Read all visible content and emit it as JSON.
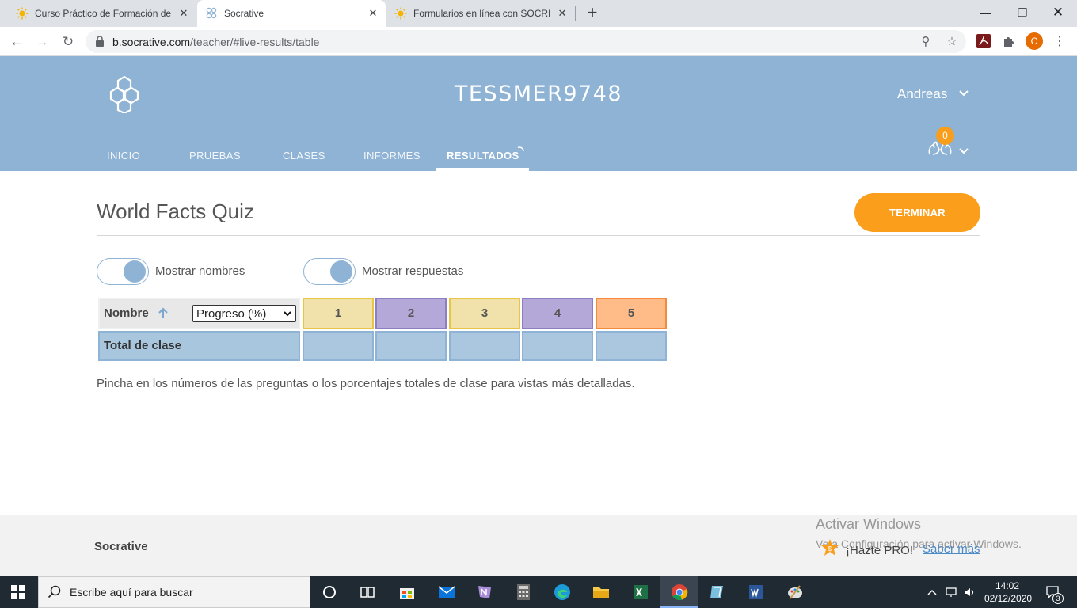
{
  "browser": {
    "tabs": [
      {
        "title": "Curso Práctico de Formación de P",
        "active": false
      },
      {
        "title": "Socrative",
        "active": true
      },
      {
        "title": "Formularios en línea con SOCREA",
        "active": false
      }
    ],
    "url_host": "b.socrative.com",
    "url_path": "/teacher/#live-results/table",
    "profile_initial": "C"
  },
  "header": {
    "room_name": "TESSMER9748",
    "user_name": "Andreas",
    "hands_count": "0",
    "nav": [
      {
        "label": "INICIO"
      },
      {
        "label": "PRUEBAS"
      },
      {
        "label": "CLASES"
      },
      {
        "label": "INFORMES"
      },
      {
        "label": "RESULTADOS",
        "active": true
      }
    ]
  },
  "main": {
    "quiz_title": "World Facts Quiz",
    "end_button": "TERMINAR",
    "toggles": [
      {
        "label": "Mostrar nombres",
        "on": true
      },
      {
        "label": "Mostrar respuestas",
        "on": true
      }
    ],
    "table": {
      "name_header": "Nombre",
      "progress_select": "Progreso (%)",
      "questions": [
        {
          "number": "1",
          "color": "#f0e2aa",
          "border": "#e8c545"
        },
        {
          "number": "2",
          "color": "#b4a8d8",
          "border": "#8c7ec0"
        },
        {
          "number": "3",
          "color": "#f0e2aa",
          "border": "#e8c545"
        },
        {
          "number": "4",
          "color": "#b4a8d8",
          "border": "#8c7ec0"
        },
        {
          "number": "5",
          "color": "#ffbb88",
          "border": "#f58a3c"
        }
      ],
      "total_label": "Total de clase"
    },
    "hint": "Pincha en los números de las preguntas o los porcentajes totales de clase para vistas más detalladas."
  },
  "footer": {
    "brand": "Socrative",
    "pro_text": "¡Hazte PRO!",
    "pro_link": "Saber más"
  },
  "watermark": {
    "title": "Activar Windows",
    "subtitle": "Ve a Configuración para activar Windows."
  },
  "taskbar": {
    "search_placeholder": "Escribe aquí para buscar",
    "time": "14:02",
    "date": "02/12/2020",
    "notification_count": "3"
  },
  "colors": {
    "header_bg": "#8fb3d4",
    "accent_orange": "#fa9e1b"
  }
}
